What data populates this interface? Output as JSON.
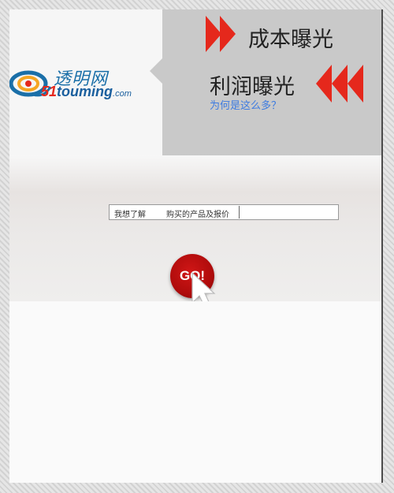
{
  "logo": {
    "brand_cn": "透明网",
    "brand_en_num": "51",
    "brand_en_text": "touming",
    "brand_en_suffix": ".com"
  },
  "banner": {
    "cost_label": "成本曝光",
    "profit_label": "利润曝光",
    "why_link": "为何是这么多？"
  },
  "search": {
    "prefix_label": "我想了解",
    "subject_label": "购买的产品及报价",
    "input_value": ""
  },
  "go_button": {
    "label": "GO!"
  },
  "colors": {
    "accent_red": "#e5281c",
    "go_red": "#b00c0c",
    "panel_gray": "#c9c9c9",
    "link_blue": "#3d7be0",
    "brand_blue": "#1a6fa8"
  },
  "icons": {
    "logo_mark": "swirl-logo-icon",
    "arrows_right": "double-arrow-right-icon",
    "arrows_left": "triple-arrow-left-icon",
    "cursor": "mouse-pointer-icon"
  }
}
